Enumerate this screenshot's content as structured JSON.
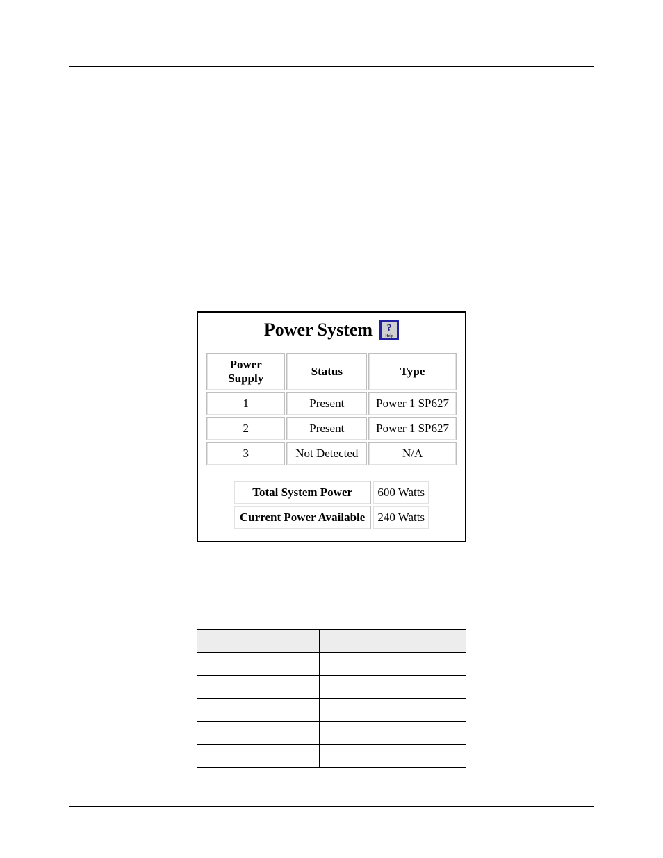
{
  "power_panel": {
    "title": "Power System",
    "help_label": "Help",
    "supplies": {
      "headers": {
        "ps": "Power Supply",
        "status": "Status",
        "type": "Type"
      },
      "rows": [
        {
          "ps": "1",
          "status": "Present",
          "type": "Power 1 SP627"
        },
        {
          "ps": "2",
          "status": "Present",
          "type": "Power 1 SP627"
        },
        {
          "ps": "3",
          "status": "Not Detected",
          "type": "N/A"
        }
      ]
    },
    "summary": {
      "total_label": "Total System Power",
      "total_value": "600 Watts",
      "avail_label": "Current Power Available",
      "avail_value": "240 Watts"
    }
  },
  "spec_table": {
    "headers": {
      "c1": "",
      "c2": ""
    },
    "rows": [
      {
        "c1": "",
        "c2": ""
      },
      {
        "c1": "",
        "c2": ""
      },
      {
        "c1": "",
        "c2": ""
      },
      {
        "c1": "",
        "c2": ""
      },
      {
        "c1": "",
        "c2": ""
      }
    ]
  }
}
